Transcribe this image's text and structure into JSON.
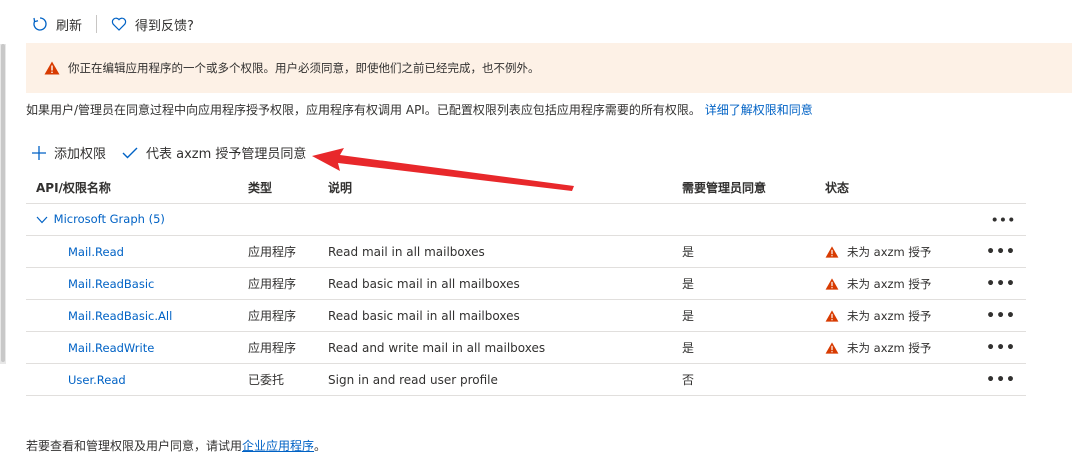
{
  "toolbar": {
    "refresh_label": "刷新",
    "feedback_label": "得到反馈?"
  },
  "banner": {
    "text": "你正在编辑应用程序的一个或多个权限。用户必须同意，即使他们之前已经完成，也不例外。"
  },
  "description": {
    "text": "如果用户/管理员在同意过程中向应用程序授予权限，应用程序有权调用 API。已配置权限列表应包括应用程序需要的所有权限。",
    "link": "详细了解权限和同意"
  },
  "actions": {
    "add_label": "添加权限",
    "grant_label": "代表 axzm 授予管理员同意"
  },
  "table": {
    "headers": {
      "name": "API/权限名称",
      "type": "类型",
      "desc": "说明",
      "admin": "需要管理员同意",
      "status": "状态"
    },
    "group": {
      "label": "Microsoft Graph (5)"
    },
    "rows": [
      {
        "name": "Mail.Read",
        "type": "应用程序",
        "desc": "Read mail in all mailboxes",
        "admin": "是",
        "status": "未为 axzm 授予"
      },
      {
        "name": "Mail.ReadBasic",
        "type": "应用程序",
        "desc": "Read basic mail in all mailboxes",
        "admin": "是",
        "status": "未为 axzm 授予"
      },
      {
        "name": "Mail.ReadBasic.All",
        "type": "应用程序",
        "desc": "Read basic mail in all mailboxes",
        "admin": "是",
        "status": "未为 axzm 授予"
      },
      {
        "name": "Mail.ReadWrite",
        "type": "应用程序",
        "desc": "Read and write mail in all mailboxes",
        "admin": "是",
        "status": "未为 axzm 授予"
      },
      {
        "name": "User.Read",
        "type": "已委托",
        "desc": "Sign in and read user profile",
        "admin": "否",
        "status": ""
      }
    ]
  },
  "footer": {
    "text": "若要查看和管理权限及用户同意，请试用",
    "link": "企业应用程序",
    "suffix": "。"
  },
  "colors": {
    "accent": "#0062c5",
    "warning": "#d83b01",
    "banner_bg": "#fdf1e6",
    "arrow": "#e8282b"
  }
}
